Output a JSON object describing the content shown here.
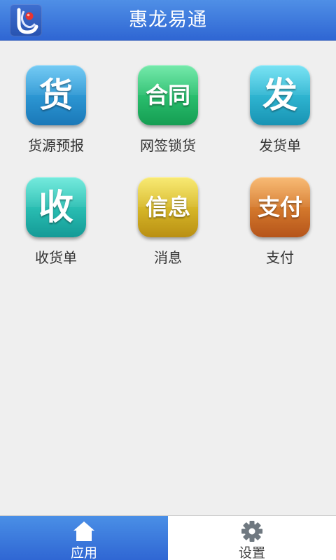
{
  "header": {
    "title": "惠龙易通",
    "logo_icon": "app-logo-icon"
  },
  "tiles": [
    {
      "glyph": "货",
      "label": "货源预报",
      "icon": "cargo-icon",
      "color_top": "#3fb6ef",
      "color_bottom": "#1a78b8"
    },
    {
      "glyph": "合同",
      "label": "网签锁货",
      "icon": "contract-icon",
      "color_top": "#3fe08a",
      "color_bottom": "#159d52"
    },
    {
      "glyph": "发",
      "label": "发货单",
      "icon": "ship-icon",
      "color_top": "#46d7ef",
      "color_bottom": "#1893b3"
    },
    {
      "glyph": "收",
      "label": "收货单",
      "icon": "receive-icon",
      "color_top": "#3fe2cf",
      "color_bottom": "#149a96"
    },
    {
      "glyph": "信息",
      "label": "消息",
      "icon": "message-icon",
      "color_top": "#f5e13e",
      "color_bottom": "#b98f13"
    },
    {
      "glyph": "支付",
      "label": "支付",
      "icon": "payment-icon",
      "color_top": "#f5a040",
      "color_bottom": "#b5541a"
    }
  ],
  "tabbar": {
    "apps_label": "应用",
    "settings_label": "设置",
    "apps_icon": "home-icon",
    "settings_icon": "gear-icon"
  }
}
